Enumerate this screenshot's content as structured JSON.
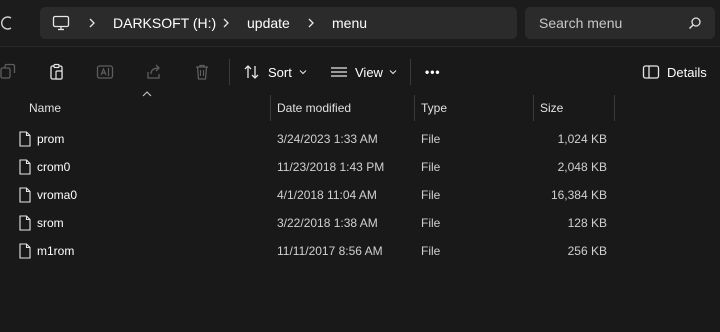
{
  "address": {
    "crumbs": [
      "DARKSOFT (H:)",
      "update",
      "menu"
    ]
  },
  "search": {
    "placeholder": "Search menu"
  },
  "toolbar": {
    "sort_label": "Sort",
    "view_label": "View",
    "more_label": "•••",
    "details_label": "Details"
  },
  "columns": {
    "name": "Name",
    "date": "Date modified",
    "type": "Type",
    "size": "Size"
  },
  "files": [
    {
      "name": "prom",
      "date": "3/24/2023 1:33 AM",
      "type": "File",
      "size": "1,024 KB"
    },
    {
      "name": "crom0",
      "date": "11/23/2018 1:43 PM",
      "type": "File",
      "size": "2,048 KB"
    },
    {
      "name": "vroma0",
      "date": "4/1/2018 11:04 AM",
      "type": "File",
      "size": "16,384 KB"
    },
    {
      "name": "srom",
      "date": "3/22/2018 1:38 AM",
      "type": "File",
      "size": "128 KB"
    },
    {
      "name": "m1rom",
      "date": "11/11/2017 8:56 AM",
      "type": "File",
      "size": "256 KB"
    }
  ]
}
